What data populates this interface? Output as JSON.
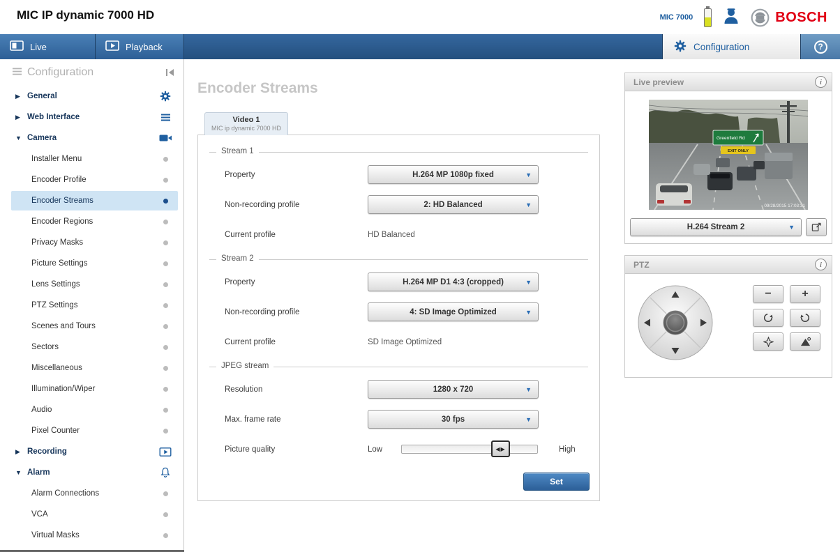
{
  "header": {
    "title": "MIC IP dynamic 7000 HD",
    "device_label": "MIC 7000",
    "brand": "BOSCH"
  },
  "nav": {
    "live": "Live",
    "playback": "Playback",
    "configuration": "Configuration"
  },
  "sidebar": {
    "title": "Configuration",
    "groups": [
      {
        "label": "General",
        "state": "collapsed"
      },
      {
        "label": "Web Interface",
        "state": "collapsed"
      },
      {
        "label": "Camera",
        "state": "expanded",
        "selected": "Encoder Streams",
        "children": [
          "Installer Menu",
          "Encoder Profile",
          "Encoder Streams",
          "Encoder Regions",
          "Privacy Masks",
          "Picture Settings",
          "Lens Settings",
          "PTZ Settings",
          "Scenes and Tours",
          "Sectors",
          "Miscellaneous",
          "Illumination/Wiper",
          "Audio",
          "Pixel Counter"
        ]
      },
      {
        "label": "Recording",
        "state": "collapsed"
      },
      {
        "label": "Alarm",
        "state": "expanded",
        "children": [
          "Alarm Connections",
          "VCA",
          "Virtual Masks"
        ]
      }
    ]
  },
  "main": {
    "title": "Encoder Streams",
    "tab": {
      "line1": "Video 1",
      "line2": "MIC ip dynamic 7000 HD"
    },
    "stream1": {
      "legend": "Stream 1",
      "property_label": "Property",
      "property_value": "H.264 MP 1080p fixed",
      "profile_label": "Non-recording profile",
      "profile_value": "2: HD Balanced",
      "current_label": "Current profile",
      "current_value": "HD Balanced"
    },
    "stream2": {
      "legend": "Stream 2",
      "property_label": "Property",
      "property_value": "H.264 MP D1 4:3 (cropped)",
      "profile_label": "Non-recording profile",
      "profile_value": "4: SD Image Optimized",
      "current_label": "Current profile",
      "current_value": "SD Image Optimized"
    },
    "jpeg": {
      "legend": "JPEG stream",
      "resolution_label": "Resolution",
      "resolution_value": "1280 x 720",
      "framerate_label": "Max. frame rate",
      "framerate_value": "30 fps",
      "quality_label": "Picture quality",
      "low": "Low",
      "high": "High"
    },
    "set_button": "Set"
  },
  "preview": {
    "title": "Live preview",
    "stream_value": "H.264 Stream 2",
    "sign_text": "Greenfield Rd",
    "exit_text": "EXIT ONLY",
    "timestamp": "09/28/2015 17:03:31"
  },
  "ptz": {
    "title": "PTZ",
    "zoom_out": "−",
    "zoom_in": "+"
  },
  "icons": {
    "help": "?",
    "info": "i",
    "dropdown_arrow": "▼",
    "tree_collapsed": "▶",
    "tree_expanded": "▼",
    "slider_handle": "◀▶"
  },
  "colors": {
    "accent_blue": "#1f5fa0",
    "nav_blue": "#2d5f96",
    "selected_bg": "#cfe4f4",
    "bosch_red": "#e10014",
    "sign_green": "#1e7b3d"
  }
}
